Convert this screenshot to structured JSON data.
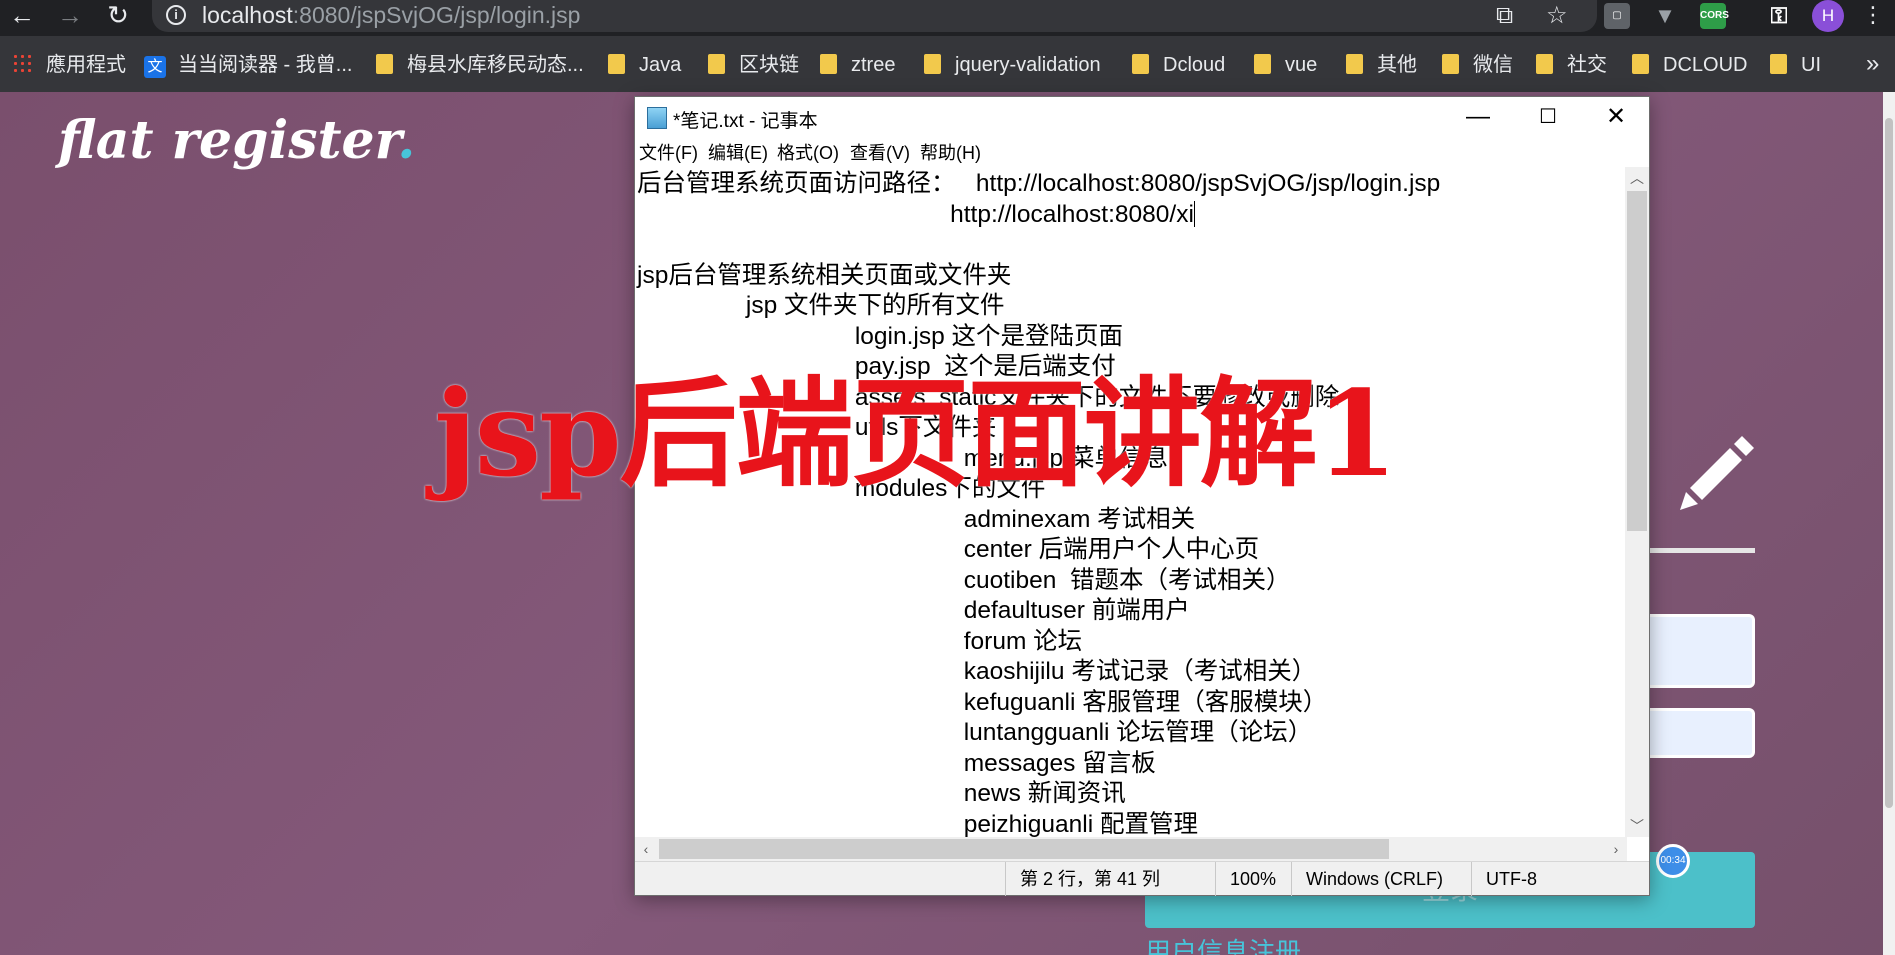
{
  "browser": {
    "url_host": "localhost",
    "url_rest": ":8080/jspSvjOG/jsp/login.jsp",
    "avatar_letter": "H",
    "cors_label": "CORS",
    "bookmarks": [
      {
        "label": "應用程式",
        "kind": "apps"
      },
      {
        "label": "当当阅读器 - 我曾...",
        "kind": "site"
      },
      {
        "label": "梅县水库移民动态...",
        "kind": "folder"
      },
      {
        "label": "Java",
        "kind": "folder"
      },
      {
        "label": "区块链",
        "kind": "folder"
      },
      {
        "label": "ztree",
        "kind": "folder"
      },
      {
        "label": "jquery-validation",
        "kind": "folder"
      },
      {
        "label": "Dcloud",
        "kind": "folder"
      },
      {
        "label": "vue",
        "kind": "folder"
      },
      {
        "label": "其他",
        "kind": "folder"
      },
      {
        "label": "微信",
        "kind": "folder"
      },
      {
        "label": "社交",
        "kind": "folder"
      },
      {
        "label": "DCLOUD",
        "kind": "folder"
      },
      {
        "label": "UI",
        "kind": "folder"
      }
    ]
  },
  "page": {
    "brand": "flat register",
    "brand_dot": ".",
    "login_button": "登录",
    "register_link": "用户信息注册",
    "timer": "00:34"
  },
  "notepad": {
    "title": "*笔记.txt - 记事本",
    "menu": [
      "文件(F)",
      "编辑(E)",
      "格式(O)",
      "查看(V)",
      "帮助(H)"
    ],
    "lines": [
      "后台管理系统页面访问路径：   http://localhost:8080/jspSvjOG/jsp/login.jsp",
      "                                              http://localhost:8080/xi",
      "",
      "jsp后台管理系统相关页面或文件夹",
      "                jsp 文件夹下的所有文件",
      "                                login.jsp 这个是登陆页面",
      "                                pay.jsp  这个是后端支付",
      "                                assets  static文件夹下的文件不要修改或删除",
      "                                utils下文件夹",
      "                                                menu.jsp 菜单信息",
      "                                modules下的文件",
      "                                                adminexam 考试相关",
      "                                                center 后端用户个人中心页",
      "                                                cuotiben  错题本（考试相关）",
      "                                                defaultuser 前端用户",
      "                                                forum 论坛",
      "                                                kaoshijilu 考试记录（考试相关）",
      "                                                kefuguanli 客服管理（客服模块）",
      "                                                luntangguanli 论坛管理（论坛）",
      "                                                messages 留言板",
      "                                                news 新闻资讯",
      "                                                peizhiguanli 配置管理"
    ],
    "status": {
      "position": "第 2 行，第 41 列",
      "zoom": "100%",
      "line_ending": "Windows (CRLF)",
      "encoding": "UTF-8"
    }
  },
  "overlay": {
    "caption": "jsp后端页面讲解1"
  }
}
